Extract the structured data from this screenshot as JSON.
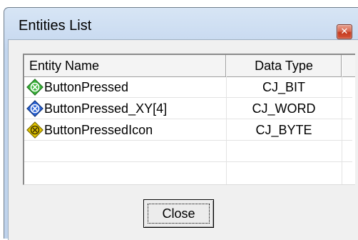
{
  "window": {
    "title": "Entities List"
  },
  "list": {
    "columns": [
      "Entity Name",
      "Data Type",
      ""
    ],
    "rows": [
      {
        "name": "ButtonPressed",
        "type": "CJ_BIT",
        "icon": "green-diamond-icon",
        "color": "#3cb83c"
      },
      {
        "name": "ButtonPressed_XY[4]",
        "type": "CJ_WORD",
        "icon": "blue-diamond-icon",
        "color": "#2a63d6"
      },
      {
        "name": "ButtonPressedIcon",
        "type": "CJ_BYTE",
        "icon": "yellow-diamond-icon",
        "color": "#e6c800"
      }
    ]
  },
  "buttons": {
    "close_label": "Close"
  }
}
